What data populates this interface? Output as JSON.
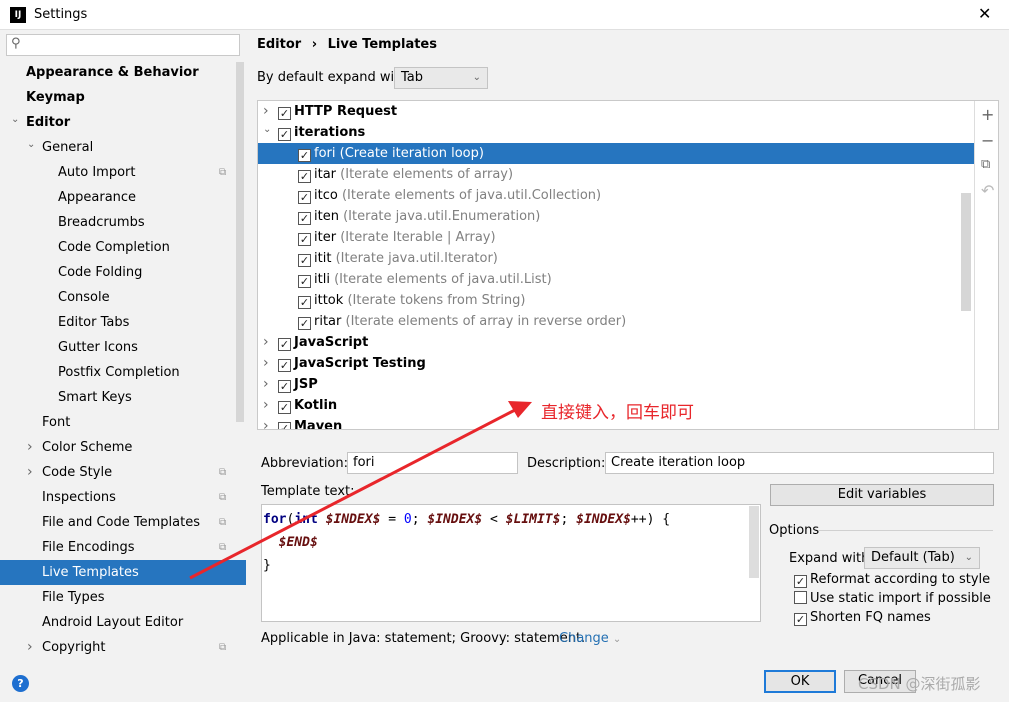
{
  "window": {
    "title": "Settings",
    "logo": "IJ"
  },
  "sidebar": {
    "search_placeholder": "",
    "items": [
      {
        "label": "Appearance & Behavior",
        "bold": true,
        "level": 0,
        "arrow": ""
      },
      {
        "label": "Keymap",
        "bold": true,
        "level": 0,
        "arrow": ""
      },
      {
        "label": "Editor",
        "bold": true,
        "level": 0,
        "arrow": "down"
      },
      {
        "label": "General",
        "level": 1,
        "arrow": "down"
      },
      {
        "label": "Auto Import",
        "level": 2,
        "copy": true
      },
      {
        "label": "Appearance",
        "level": 2
      },
      {
        "label": "Breadcrumbs",
        "level": 2
      },
      {
        "label": "Code Completion",
        "level": 2
      },
      {
        "label": "Code Folding",
        "level": 2
      },
      {
        "label": "Console",
        "level": 2
      },
      {
        "label": "Editor Tabs",
        "level": 2
      },
      {
        "label": "Gutter Icons",
        "level": 2
      },
      {
        "label": "Postfix Completion",
        "level": 2
      },
      {
        "label": "Smart Keys",
        "level": 2
      },
      {
        "label": "Font",
        "level": 1
      },
      {
        "label": "Color Scheme",
        "level": 1,
        "arrow": "right"
      },
      {
        "label": "Code Style",
        "level": 1,
        "arrow": "right",
        "copy": true
      },
      {
        "label": "Inspections",
        "level": 1,
        "copy": true
      },
      {
        "label": "File and Code Templates",
        "level": 1,
        "copy": true
      },
      {
        "label": "File Encodings",
        "level": 1,
        "copy": true
      },
      {
        "label": "Live Templates",
        "level": 1,
        "selected": true
      },
      {
        "label": "File Types",
        "level": 1
      },
      {
        "label": "Android Layout Editor",
        "level": 1
      },
      {
        "label": "Copyright",
        "level": 1,
        "arrow": "right",
        "copy": true
      }
    ]
  },
  "breadcrumb": {
    "parent": "Editor",
    "sep": "›",
    "current": "Live Templates"
  },
  "expand_default": {
    "label": "By default expand with",
    "value": "Tab"
  },
  "templates": [
    {
      "name": "HTTP Request",
      "group": true,
      "expanded": false,
      "checked": true
    },
    {
      "name": "iterations",
      "group": true,
      "expanded": true,
      "checked": true
    },
    {
      "name": "fori",
      "desc": "(Create iteration loop)",
      "checked": true,
      "selected": true
    },
    {
      "name": "itar",
      "desc": "(Iterate elements of array)",
      "checked": true
    },
    {
      "name": "itco",
      "desc": "(Iterate elements of java.util.Collection)",
      "checked": true
    },
    {
      "name": "iten",
      "desc": "(Iterate java.util.Enumeration)",
      "checked": true
    },
    {
      "name": "iter",
      "desc": "(Iterate Iterable | Array)",
      "checked": true
    },
    {
      "name": "itit",
      "desc": "(Iterate java.util.Iterator)",
      "checked": true
    },
    {
      "name": "itli",
      "desc": "(Iterate elements of java.util.List)",
      "checked": true
    },
    {
      "name": "ittok",
      "desc": "(Iterate tokens from String)",
      "checked": true
    },
    {
      "name": "ritar",
      "desc": "(Iterate elements of array in reverse order)",
      "checked": true
    },
    {
      "name": "JavaScript",
      "group": true,
      "checked": true
    },
    {
      "name": "JavaScript Testing",
      "group": true,
      "checked": true
    },
    {
      "name": "JSP",
      "group": true,
      "checked": true
    },
    {
      "name": "Kotlin",
      "group": true,
      "checked": true
    },
    {
      "name": "Maven",
      "group": true,
      "checked": true
    }
  ],
  "toolbar": {
    "add": "+",
    "remove": "−",
    "copy": "⧉",
    "revert": "↶"
  },
  "form": {
    "abbreviation_label": "Abbreviation:",
    "abbreviation": "fori",
    "description_label": "Description:",
    "description": "Create iteration loop",
    "template_text_label": "Template text:",
    "edit_variables": "Edit variables",
    "applicable": "Applicable in Java: statement; Groovy: statement.",
    "change": "Change"
  },
  "code": {
    "l1": [
      [
        "kw",
        "for"
      ],
      [
        "",
        "("
      ],
      [
        "kw",
        "int"
      ],
      [
        "",
        " "
      ],
      [
        "var",
        "$INDEX$"
      ],
      [
        "",
        " = "
      ],
      [
        "num",
        "0"
      ],
      [
        "",
        "; "
      ],
      [
        "var",
        "$INDEX$"
      ],
      [
        "",
        " < "
      ],
      [
        "var",
        "$LIMIT$"
      ],
      [
        "",
        "; "
      ],
      [
        "var",
        "$INDEX$"
      ],
      [
        "",
        "++) {"
      ]
    ],
    "l2": [
      [
        "",
        "  "
      ],
      [
        "var",
        "$END$"
      ]
    ],
    "l3": [
      [
        "",
        "}"
      ]
    ]
  },
  "options": {
    "title": "Options",
    "expand_label": "Expand with",
    "expand_value": "Default (Tab)",
    "checks": [
      {
        "label": "Reformat according to style",
        "checked": true
      },
      {
        "label": "Use static import if possible",
        "checked": false
      },
      {
        "label": "Shorten FQ names",
        "checked": true
      }
    ]
  },
  "buttons": {
    "ok": "OK",
    "cancel": "Cancel"
  },
  "annotation": "直接键入，回车即可",
  "watermark": "CSDN @深街孤影",
  "colors": {
    "selection": "#2675bf",
    "annotation": "#e8262b"
  }
}
